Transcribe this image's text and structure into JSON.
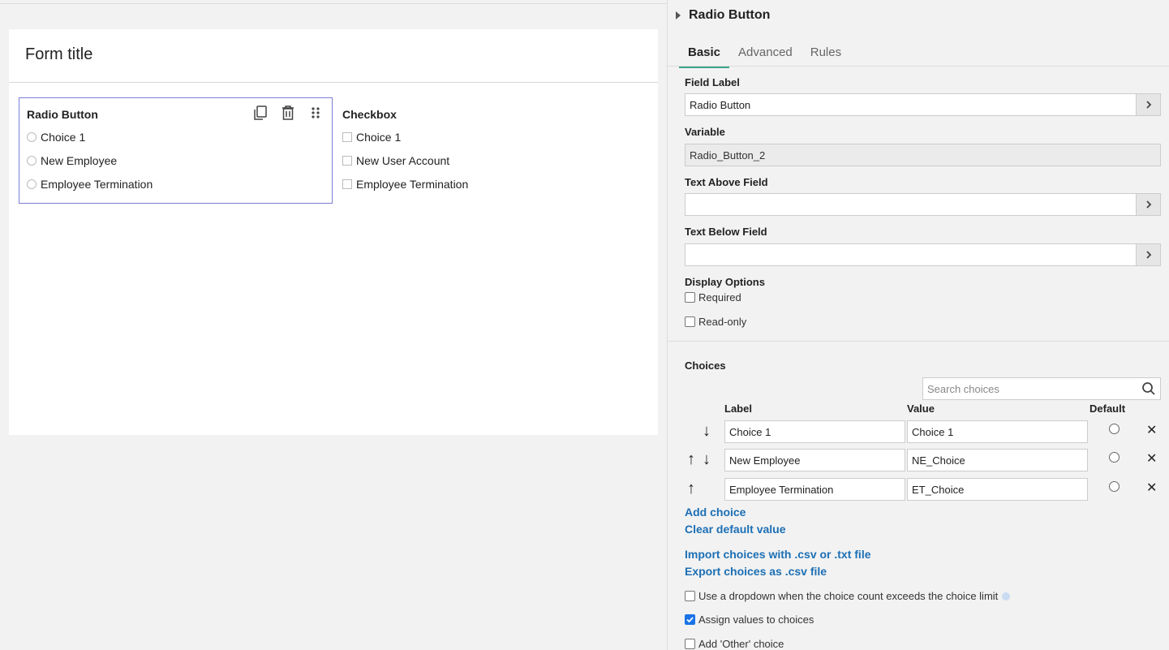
{
  "form": {
    "title": "Form title",
    "radio_field": {
      "label": "Radio Button",
      "options": [
        "Choice 1",
        "New Employee",
        "Employee Termination"
      ]
    },
    "checkbox_field": {
      "label": "Checkbox",
      "options": [
        "Choice 1",
        "New User Account",
        "Employee Termination"
      ]
    }
  },
  "panel": {
    "title": "Radio Button",
    "tabs": [
      "Basic",
      "Advanced",
      "Rules"
    ],
    "active_tab": "Basic",
    "field_label_title": "Field Label",
    "field_label_value": "Radio Button",
    "variable_title": "Variable",
    "variable_value": "Radio_Button_2",
    "text_above_title": "Text Above Field",
    "text_above_value": "",
    "text_below_title": "Text Below Field",
    "text_below_value": "",
    "display_options_title": "Display Options",
    "required_label": "Required",
    "readonly_label": "Read-only",
    "choices_title": "Choices",
    "search_placeholder": "Search choices",
    "col_label": "Label",
    "col_value": "Value",
    "col_default": "Default",
    "choices": [
      {
        "label": "Choice 1",
        "value": "Choice 1"
      },
      {
        "label": "New Employee",
        "value": "NE_Choice"
      },
      {
        "label": "Employee Termination",
        "value": "ET_Choice"
      }
    ],
    "add_choice": "Add choice",
    "clear_default": "Clear default value",
    "import_choices": "Import choices with .csv or .txt file",
    "export_choices": "Export choices as .csv file",
    "dropdown_option": "Use a dropdown when the choice count exceeds the choice limit",
    "assign_values": "Assign values to choices",
    "assign_values_checked": true,
    "add_other": "Add 'Other' choice"
  },
  "colors": {
    "accent_tab": "#3aa48a",
    "link": "#1c6fb5",
    "selected_border": "#7b7fd4",
    "checkbox_checked": "#1a73e8"
  }
}
